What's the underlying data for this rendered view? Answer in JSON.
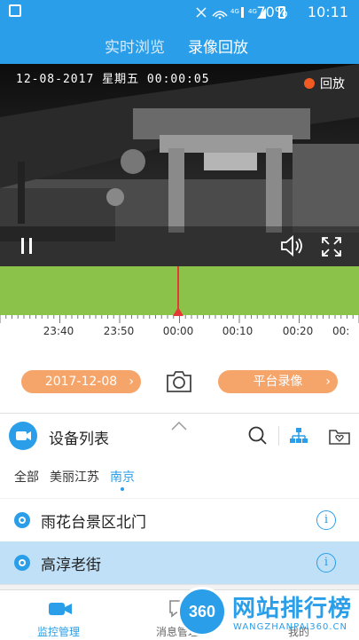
{
  "status_bar": {
    "icons": "4G 4G",
    "battery": "70%",
    "time": "10:11"
  },
  "header": {
    "tabs": [
      {
        "label": "实时浏览",
        "active": false
      },
      {
        "label": "录像回放",
        "active": true
      }
    ]
  },
  "video": {
    "osd_datetime": "12-08-2017  星期五  00:00:05",
    "playback_badge": "回放"
  },
  "timeline": {
    "ticks": [
      "23:40",
      "23:50",
      "00:00",
      "00:10",
      "00:20",
      "00:"
    ]
  },
  "controls": {
    "date_button": "2017-12-08",
    "platform_record_button": "平台录像"
  },
  "device_list": {
    "title": "设备列表",
    "filters": [
      {
        "label": "全部",
        "active": false
      },
      {
        "label": "美丽江苏",
        "active": false
      },
      {
        "label": "南京",
        "active": true
      }
    ],
    "devices": [
      {
        "label": "雨花台景区北门",
        "selected": false
      },
      {
        "label": "高淳老街",
        "selected": true
      }
    ]
  },
  "bottom_nav": {
    "items": [
      {
        "label": "监控管理",
        "active": true
      },
      {
        "label": "消息管理",
        "active": false
      },
      {
        "label": "我的",
        "active": false
      }
    ]
  },
  "watermark": {
    "text": "网站排行榜",
    "subtext": "WANGZHANPAI360.CN",
    "badge": "360"
  },
  "colors": {
    "primary": "#2a9ee8",
    "timeline_fill": "#8bc34a",
    "playhead": "#e53935",
    "pill": "#f6a56a",
    "selected_row": "#bfe0f7"
  }
}
